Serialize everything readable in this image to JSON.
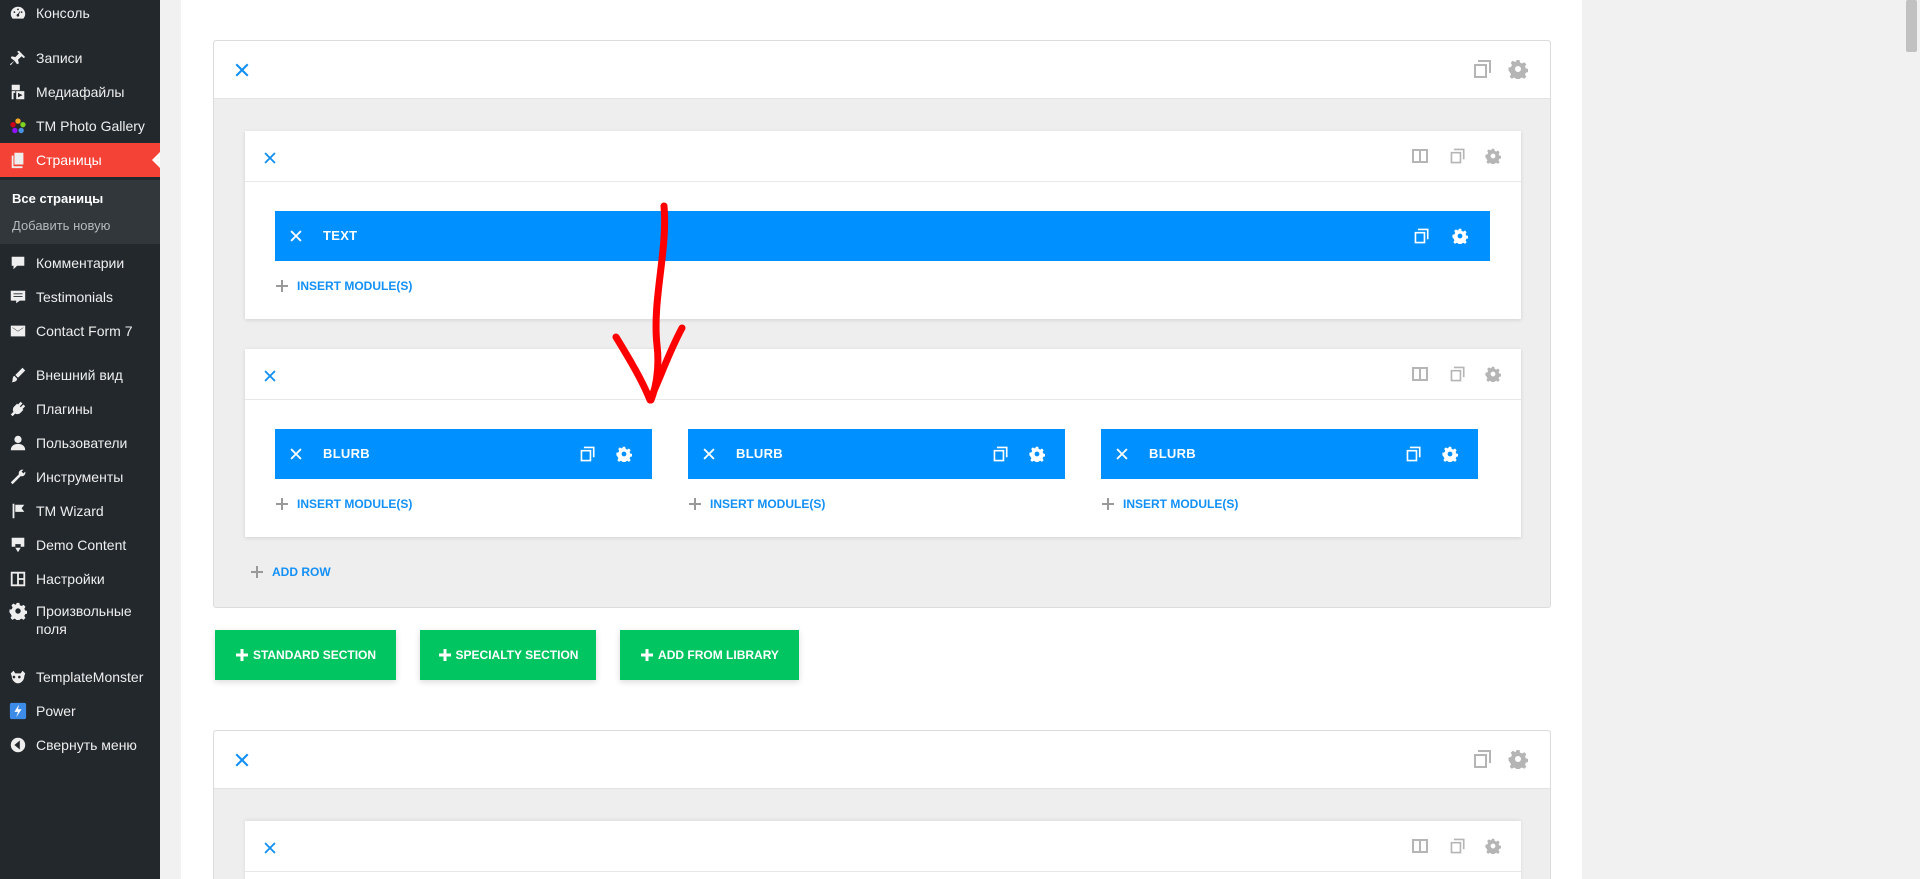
{
  "sidebar": {
    "items": [
      {
        "label": "Консоль",
        "icon": "dashboard-icon"
      },
      {
        "label": "Записи",
        "icon": "pin-icon"
      },
      {
        "label": "Медиафайлы",
        "icon": "media-icon"
      },
      {
        "label": "TM Photo Gallery",
        "icon": "flower-icon"
      },
      {
        "label": "Страницы",
        "icon": "pages-icon"
      },
      {
        "label": "Комментарии",
        "icon": "comment-icon"
      },
      {
        "label": "Testimonials",
        "icon": "testimonial-icon"
      },
      {
        "label": "Contact Form 7",
        "icon": "mail-icon"
      },
      {
        "label": "Внешний вид",
        "icon": "brush-icon"
      },
      {
        "label": "Плагины",
        "icon": "plugin-icon"
      },
      {
        "label": "Пользователи",
        "icon": "user-icon"
      },
      {
        "label": "Инструменты",
        "icon": "wrench-icon"
      },
      {
        "label": "TM Wizard",
        "icon": "flag-icon"
      },
      {
        "label": "Demo Content",
        "icon": "download-icon"
      },
      {
        "label": "Настройки",
        "icon": "settings-icon"
      },
      {
        "label": "Произвольные поля",
        "icon": "gear-icon"
      },
      {
        "label": "TemplateMonster",
        "icon": "templatemonster-icon"
      },
      {
        "label": "Power",
        "icon": "power-icon"
      },
      {
        "label": "Свернуть меню",
        "icon": "collapse-icon"
      }
    ],
    "submenu": {
      "all_pages": "Все страницы",
      "add_new": "Добавить новую"
    }
  },
  "builder": {
    "module_text": "TEXT",
    "module_blurb": "BLURB",
    "insert_module": "INSERT MODULE(S)",
    "add_row": "ADD ROW",
    "buttons": {
      "standard": "STANDARD SECTION",
      "specialty": "SPECIALTY SECTION",
      "library": "ADD FROM LIBRARY"
    }
  },
  "colors": {
    "module_blue": "#0090ff",
    "green": "#00c560",
    "sidebar_bg": "#23282d",
    "active_red": "#f44336",
    "arrow_red": "#ff0000"
  }
}
